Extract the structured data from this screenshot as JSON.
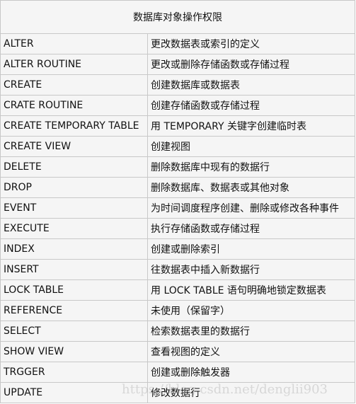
{
  "table": {
    "title": "数据库对象操作权限",
    "rows": [
      {
        "privilege": "ALTER",
        "description": "更改数据表或索引的定义"
      },
      {
        "privilege": "ALTER ROUTINE",
        "description": "更改或删除存储函数或存储过程"
      },
      {
        "privilege": "CREATE",
        "description": "创建数据库或数据表"
      },
      {
        "privilege": "CRATE ROUTINE",
        "description": "创建存储函数或存储过程"
      },
      {
        "privilege": "CREATE TEMPORARY TABLE",
        "description": "用 TEMPORARY 关键字创建临时表"
      },
      {
        "privilege": "CREATE VIEW",
        "description": "创建视图"
      },
      {
        "privilege": "DELETE",
        "description": "删除数据库中现有的数据行"
      },
      {
        "privilege": "DROP",
        "description": "删除数据库、数据表或其他对象"
      },
      {
        "privilege": "EVENT",
        "description": "为时间调度程序创建、删除或修改各种事件"
      },
      {
        "privilege": "EXECUTE",
        "description": "执行存储函数或存储过程"
      },
      {
        "privilege": "INDEX",
        "description": "创建或删除索引"
      },
      {
        "privilege": "INSERT",
        "description": "往数据表中插入新数据行"
      },
      {
        "privilege": "LOCK TABLE",
        "description": "用 LOCK TABLE 语句明确地锁定数据表"
      },
      {
        "privilege": "REFERENCE",
        "description": "未使用（保留字）"
      },
      {
        "privilege": "SELECT",
        "description": "检索数据表里的数据行"
      },
      {
        "privilege": "SHOW VIEW",
        "description": "查看视图的定义"
      },
      {
        "privilege": "TRGGER",
        "description": "创建或删除触发器"
      },
      {
        "privilege": "UPDATE",
        "description": "修改数据行"
      }
    ]
  },
  "watermark": "https://blog.csdn.net/denglii903"
}
